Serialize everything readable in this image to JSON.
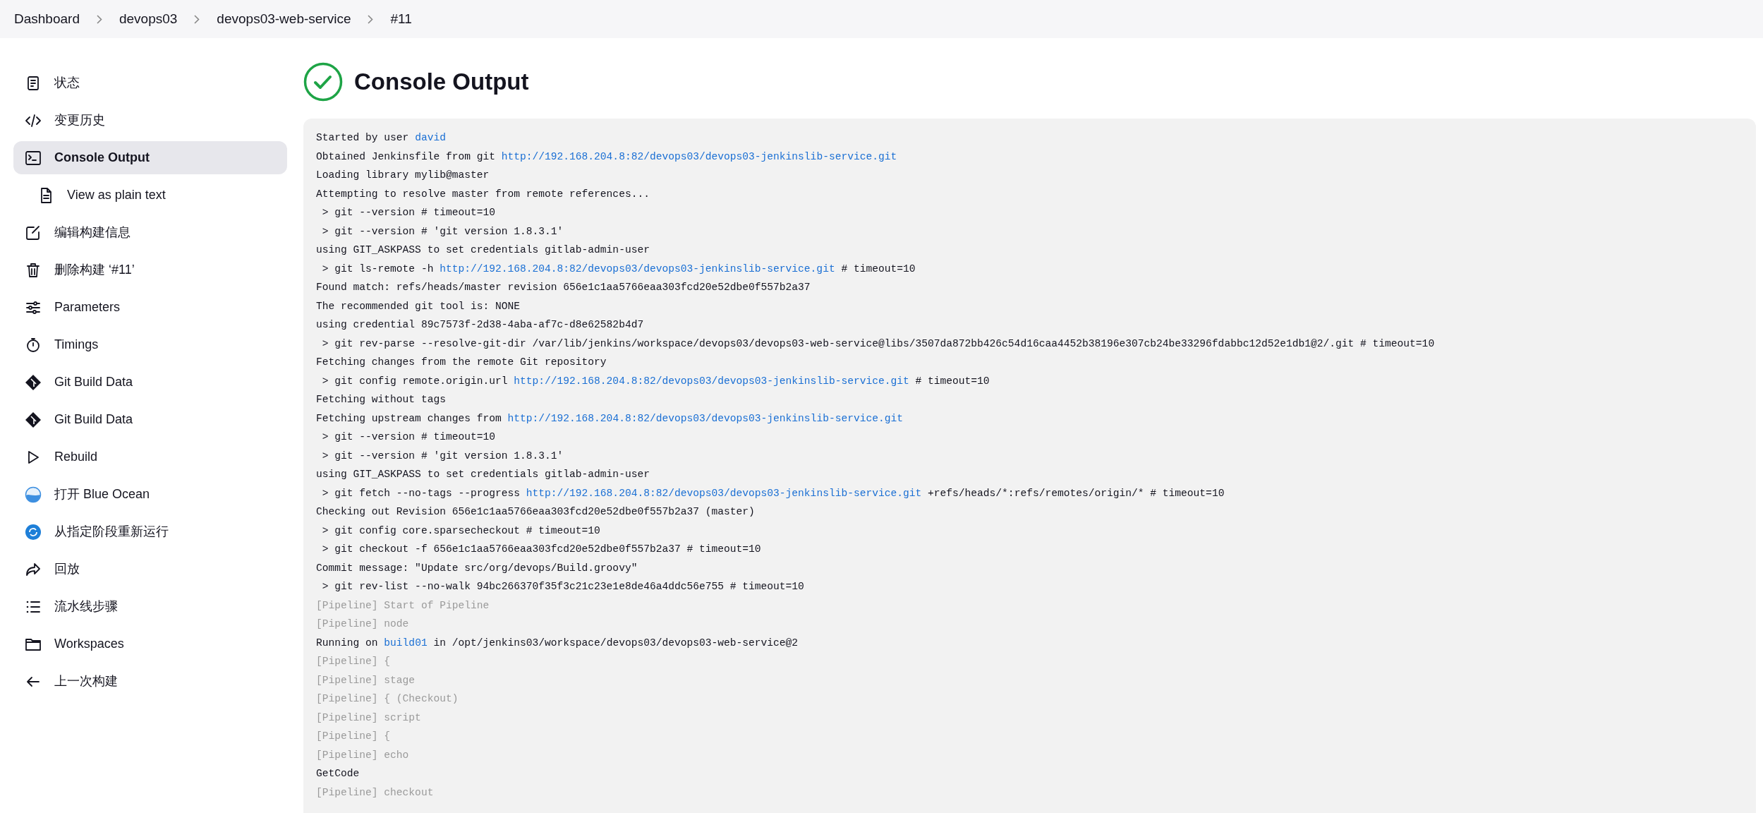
{
  "breadcrumb": [
    {
      "label": "Dashboard"
    },
    {
      "label": "devops03"
    },
    {
      "label": "devops03-web-service"
    },
    {
      "label": "#11"
    }
  ],
  "sidebar": {
    "items": [
      {
        "label": "状态",
        "selected": false
      },
      {
        "label": "变更历史",
        "selected": false
      },
      {
        "label": "Console Output",
        "selected": true,
        "children": [
          {
            "label": "View as plain text",
            "selected": false
          }
        ]
      },
      {
        "label": "编辑构建信息",
        "selected": false
      },
      {
        "label": "删除构建 ‘#11’",
        "selected": false
      },
      {
        "label": "Parameters",
        "selected": false
      },
      {
        "label": "Timings",
        "selected": false
      },
      {
        "label": "Git Build Data",
        "selected": false
      },
      {
        "label": "Git Build Data",
        "selected": false
      },
      {
        "label": "Rebuild",
        "selected": false
      },
      {
        "label": "打开 Blue Ocean",
        "selected": false
      },
      {
        "label": "从指定阶段重新运行",
        "selected": false
      },
      {
        "label": "回放",
        "selected": false
      },
      {
        "label": "流水线步骤",
        "selected": false
      },
      {
        "label": "Workspaces",
        "selected": false
      },
      {
        "label": "上一次构建",
        "selected": false
      }
    ]
  },
  "page": {
    "title": "Console Output",
    "build_succeeded": true
  },
  "console": {
    "lines": [
      {
        "kind": "log",
        "parts": [
          {
            "kind": "text",
            "text": "Started by user "
          },
          {
            "kind": "link",
            "text": "david"
          }
        ]
      },
      {
        "kind": "log",
        "parts": [
          {
            "kind": "text",
            "text": "Obtained Jenkinsfile from git "
          },
          {
            "kind": "link",
            "text": "http://192.168.204.8:82/devops03/devops03-jenkinslib-service.git"
          }
        ]
      },
      {
        "kind": "log",
        "parts": [
          {
            "kind": "text",
            "text": "Loading library mylib@master"
          }
        ]
      },
      {
        "kind": "log",
        "parts": [
          {
            "kind": "text",
            "text": "Attempting to resolve master from remote references..."
          }
        ]
      },
      {
        "kind": "log",
        "parts": [
          {
            "kind": "text",
            "text": " > git --version # timeout=10"
          }
        ]
      },
      {
        "kind": "log",
        "parts": [
          {
            "kind": "text",
            "text": " > git --version # 'git version 1.8.3.1'"
          }
        ]
      },
      {
        "kind": "log",
        "parts": [
          {
            "kind": "text",
            "text": "using GIT_ASKPASS to set credentials gitlab-admin-user"
          }
        ]
      },
      {
        "kind": "log",
        "parts": [
          {
            "kind": "text",
            "text": " > git ls-remote -h "
          },
          {
            "kind": "link",
            "text": "http://192.168.204.8:82/devops03/devops03-jenkinslib-service.git"
          },
          {
            "kind": "text",
            "text": " # timeout=10"
          }
        ]
      },
      {
        "kind": "log",
        "parts": [
          {
            "kind": "text",
            "text": "Found match: refs/heads/master revision 656e1c1aa5766eaa303fcd20e52dbe0f557b2a37"
          }
        ]
      },
      {
        "kind": "log",
        "parts": [
          {
            "kind": "text",
            "text": "The recommended git tool is: NONE"
          }
        ]
      },
      {
        "kind": "log",
        "parts": [
          {
            "kind": "text",
            "text": "using credential 89c7573f-2d38-4aba-af7c-d8e62582b4d7"
          }
        ]
      },
      {
        "kind": "log",
        "parts": [
          {
            "kind": "text",
            "text": " > git rev-parse --resolve-git-dir /var/lib/jenkins/workspace/devops03/devops03-web-service@libs/3507da872bb426c54d16caa4452b38196e307cb24be33296fdabbc12d52e1db1@2/.git # timeout=10"
          }
        ]
      },
      {
        "kind": "log",
        "parts": [
          {
            "kind": "text",
            "text": "Fetching changes from the remote Git repository"
          }
        ]
      },
      {
        "kind": "log",
        "parts": [
          {
            "kind": "text",
            "text": " > git config remote.origin.url "
          },
          {
            "kind": "link",
            "text": "http://192.168.204.8:82/devops03/devops03-jenkinslib-service.git"
          },
          {
            "kind": "text",
            "text": " # timeout=10"
          }
        ]
      },
      {
        "kind": "log",
        "parts": [
          {
            "kind": "text",
            "text": "Fetching without tags"
          }
        ]
      },
      {
        "kind": "log",
        "parts": [
          {
            "kind": "text",
            "text": "Fetching upstream changes from "
          },
          {
            "kind": "link",
            "text": "http://192.168.204.8:82/devops03/devops03-jenkinslib-service.git"
          }
        ]
      },
      {
        "kind": "log",
        "parts": [
          {
            "kind": "text",
            "text": " > git --version # timeout=10"
          }
        ]
      },
      {
        "kind": "log",
        "parts": [
          {
            "kind": "text",
            "text": " > git --version # 'git version 1.8.3.1'"
          }
        ]
      },
      {
        "kind": "log",
        "parts": [
          {
            "kind": "text",
            "text": "using GIT_ASKPASS to set credentials gitlab-admin-user"
          }
        ]
      },
      {
        "kind": "log",
        "parts": [
          {
            "kind": "text",
            "text": " > git fetch --no-tags --progress "
          },
          {
            "kind": "link",
            "text": "http://192.168.204.8:82/devops03/devops03-jenkinslib-service.git"
          },
          {
            "kind": "text",
            "text": " +refs/heads/*:refs/remotes/origin/* # timeout=10"
          }
        ]
      },
      {
        "kind": "log",
        "parts": [
          {
            "kind": "text",
            "text": "Checking out Revision 656e1c1aa5766eaa303fcd20e52dbe0f557b2a37 (master)"
          }
        ]
      },
      {
        "kind": "log",
        "parts": [
          {
            "kind": "text",
            "text": " > git config core.sparsecheckout # timeout=10"
          }
        ]
      },
      {
        "kind": "log",
        "parts": [
          {
            "kind": "text",
            "text": " > git checkout -f 656e1c1aa5766eaa303fcd20e52dbe0f557b2a37 # timeout=10"
          }
        ]
      },
      {
        "kind": "log",
        "parts": [
          {
            "kind": "text",
            "text": "Commit message: \"Update src/org/devops/Build.groovy\""
          }
        ]
      },
      {
        "kind": "log",
        "parts": [
          {
            "kind": "text",
            "text": " > git rev-list --no-walk 94bc266370f35f3c21c23e1e8de46a4ddc56e755 # timeout=10"
          }
        ]
      },
      {
        "kind": "pipeline",
        "parts": [
          {
            "kind": "text",
            "text": "[Pipeline] Start of Pipeline"
          }
        ]
      },
      {
        "kind": "pipeline",
        "parts": [
          {
            "kind": "text",
            "text": "[Pipeline] node"
          }
        ]
      },
      {
        "kind": "log",
        "parts": [
          {
            "kind": "text",
            "text": "Running on "
          },
          {
            "kind": "link",
            "text": "build01"
          },
          {
            "kind": "text",
            "text": " in /opt/jenkins03/workspace/devops03/devops03-web-service@2"
          }
        ]
      },
      {
        "kind": "pipeline",
        "parts": [
          {
            "kind": "text",
            "text": "[Pipeline] {"
          }
        ]
      },
      {
        "kind": "pipeline",
        "parts": [
          {
            "kind": "text",
            "text": "[Pipeline] stage"
          }
        ]
      },
      {
        "kind": "pipeline",
        "parts": [
          {
            "kind": "text",
            "text": "[Pipeline] { (Checkout)"
          }
        ]
      },
      {
        "kind": "pipeline",
        "parts": [
          {
            "kind": "text",
            "text": "[Pipeline] script"
          }
        ]
      },
      {
        "kind": "pipeline",
        "parts": [
          {
            "kind": "text",
            "text": "[Pipeline] {"
          }
        ]
      },
      {
        "kind": "pipeline",
        "parts": [
          {
            "kind": "text",
            "text": "[Pipeline] echo"
          }
        ]
      },
      {
        "kind": "log",
        "parts": [
          {
            "kind": "text",
            "text": "GetCode"
          }
        ]
      },
      {
        "kind": "pipeline",
        "parts": [
          {
            "kind": "text",
            "text": "[Pipeline] checkout"
          }
        ]
      }
    ]
  }
}
